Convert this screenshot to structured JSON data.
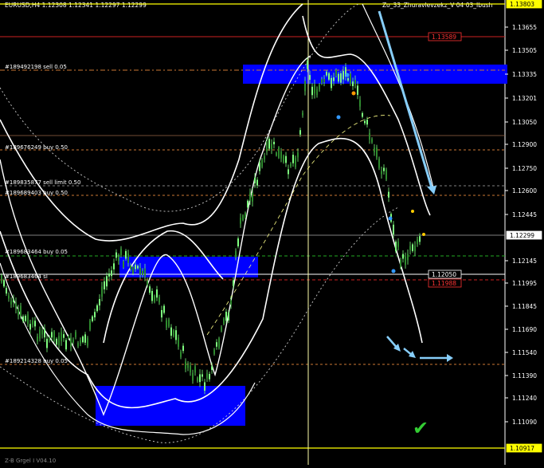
{
  "header": {
    "symbol_info": "EURUSD,H4 1.12308 1.12341 1.12297 1.12299",
    "indicator_name": "Zo_33_Zhuravlevzekz_V 04 03_Ibush"
  },
  "footer_label": "Z-B Grgel I V04.10",
  "price_axis": {
    "ticks": [
      "1.13655",
      "1.13505",
      "1.13335",
      "1.13201",
      "1.13050",
      "1.12900",
      "1.12750",
      "1.12600",
      "1.12445",
      "1.12145",
      "1.11995",
      "1.11845",
      "1.11690",
      "1.11540",
      "1.11390",
      "1.11240",
      "1.11090"
    ],
    "markers": [
      {
        "label": "1.13803",
        "color": "#ffff00"
      },
      {
        "label": "1.13589",
        "color": "#ff3333"
      },
      {
        "label": "1.12299",
        "color": "#ffffff"
      },
      {
        "label": "1.12050",
        "color": "#ffffff"
      },
      {
        "label": "1.11988",
        "color": "#ff3333"
      },
      {
        "label": "1.10917",
        "color": "#ffff00"
      }
    ]
  },
  "order_labels": [
    "#189492198 sell 0.05",
    "#189676249 buy 0.50",
    "#189835877 sell limit 0.50",
    "#189689403 buy 0.50",
    "#189683464 buy 0.05",
    "#189683464 sl",
    "#189214328 buy 0.05"
  ],
  "annotations": {
    "checkmark": "✔"
  },
  "colors": {
    "background": "#000000",
    "candles": "#7fff7f",
    "zones": "#0000ff",
    "arrows": "#87cefa",
    "bands": "#ffffff",
    "checkmark": "#33cc33"
  },
  "icons": [
    "checkmark-icon",
    "arrow-down-right-icon",
    "arrow-right-icon"
  ]
}
